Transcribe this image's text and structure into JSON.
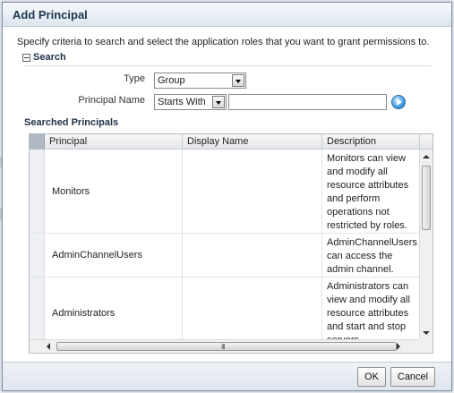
{
  "dialog": {
    "title": "Add Principal",
    "instruction": "Specify criteria to search and select the application roles that you want to grant permissions to."
  },
  "search": {
    "section_label": "Search",
    "type_label": "Type",
    "type_value": "Group",
    "principal_name_label": "Principal Name",
    "match_value": "Starts With",
    "name_value": "",
    "go_icon": "go-arrow-icon"
  },
  "results": {
    "heading": "Searched Principals",
    "columns": [
      "Principal",
      "Display Name",
      "Description"
    ],
    "rows": [
      {
        "principal": "Monitors",
        "display_name": "",
        "description": "Monitors can view and modify all resource attributes and perform operations not restricted by roles."
      },
      {
        "principal": "AdminChannelUsers",
        "display_name": "",
        "description": "AdminChannelUsers can access the admin channel."
      },
      {
        "principal": "Administrators",
        "display_name": "",
        "description": "Administrators can view and modify all resource attributes and start and stop servers."
      }
    ],
    "hscroll_grip": "III"
  },
  "footer": {
    "ok_label": "OK",
    "cancel_label": "Cancel"
  },
  "colors": {
    "title_text": "#1e3550",
    "dialog_border": "#7f93a8",
    "header_select": "#b0b8c2"
  }
}
